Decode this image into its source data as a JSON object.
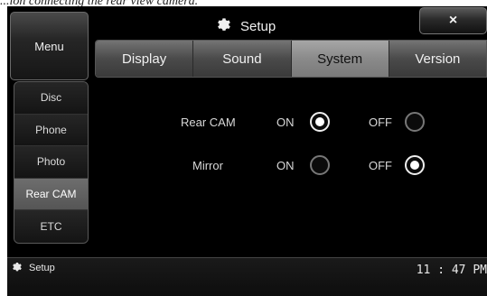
{
  "caption": "...ion connecting the rear view camera.",
  "header": {
    "menu_label": "Menu",
    "title": "Setup",
    "close_label": "×",
    "icon": "gear-icon"
  },
  "tabs": [
    {
      "label": "Display",
      "active": false
    },
    {
      "label": "Sound",
      "active": false
    },
    {
      "label": "System",
      "active": true
    },
    {
      "label": "Version",
      "active": false
    }
  ],
  "sidebar": {
    "items": [
      {
        "label": "Disc",
        "active": false
      },
      {
        "label": "Phone",
        "active": false
      },
      {
        "label": "Photo",
        "active": false
      },
      {
        "label": "Rear CAM",
        "active": true
      },
      {
        "label": "ETC",
        "active": false
      }
    ]
  },
  "settings": [
    {
      "label": "Rear CAM",
      "on_label": "ON",
      "off_label": "OFF",
      "selected": "ON"
    },
    {
      "label": "Mirror",
      "on_label": "ON",
      "off_label": "OFF",
      "selected": "OFF"
    }
  ],
  "status_bar": {
    "app_label": "Setup",
    "icon": "gear-icon",
    "time": "11 : 47 PM"
  }
}
